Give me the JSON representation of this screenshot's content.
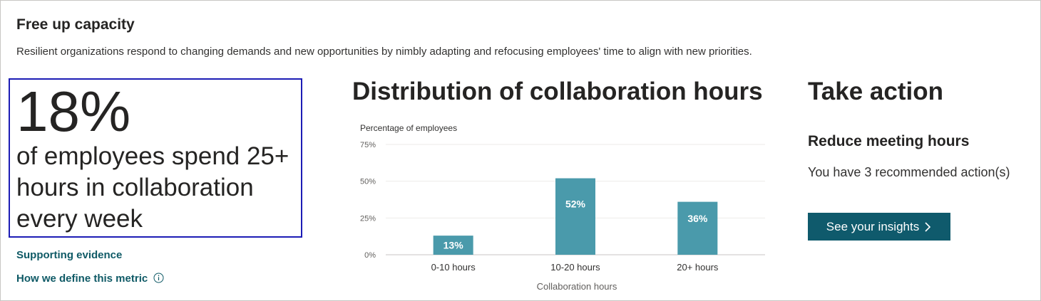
{
  "card": {
    "title": "Free up capacity",
    "subtitle": "Resilient organizations respond to changing demands and new opportunities by nimbly adapting and refocusing employees' time to align with new priorities."
  },
  "stat": {
    "value": "18%",
    "description": "of employees spend 25+ hours in collaboration every week"
  },
  "links": {
    "supporting_evidence": "Supporting evidence",
    "define_metric": "How we define this metric"
  },
  "chart_title": "Distribution of collaboration hours",
  "chart_data": {
    "type": "bar",
    "title": "Distribution of collaboration hours",
    "ylabel": "Percentage of employees",
    "xlabel": "Collaboration hours",
    "categories": [
      "0-10 hours",
      "10-20 hours",
      "20+ hours"
    ],
    "values": [
      13,
      52,
      36
    ],
    "value_labels": [
      "13%",
      "52%",
      "36%"
    ],
    "yticks": [
      "0%",
      "25%",
      "50%",
      "75%"
    ],
    "ytick_values": [
      0,
      25,
      50,
      75
    ],
    "ylim": [
      0,
      75
    ],
    "grid": true,
    "bar_color": "#4a9aab"
  },
  "action": {
    "title": "Take action",
    "subtitle": "Reduce meeting hours",
    "description": "You have 3 recommended action(s)",
    "button_label": "See your insights",
    "button_icon": "chevron-right-icon"
  },
  "colors": {
    "accent": "#0f5a6c",
    "link": "#0f5a66",
    "highlight_border": "#1c1cb5"
  }
}
